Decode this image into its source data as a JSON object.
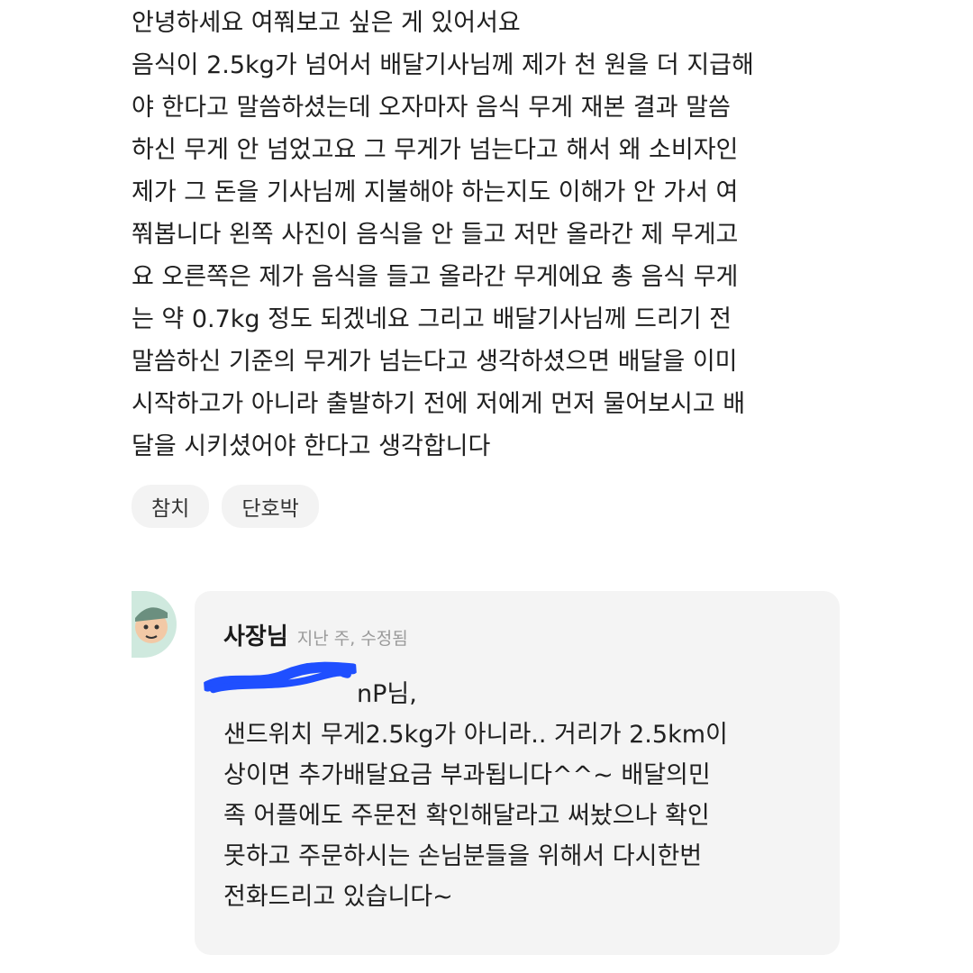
{
  "review": {
    "lines": [
      "안녕하세요 여쭤보고 싶은 게 있어서요",
      "음식이 2.5kg가 넘어서 배달기사님께 제가 천 원을 더 지급해",
      "야 한다고 말씀하셨는데 오자마자 음식 무게 재본 결과 말씀",
      "하신 무게 안 넘었고요 그 무게가 넘는다고 해서 왜 소비자인",
      "제가 그 돈을 기사님께 지불해야 하는지도 이해가 안 가서 여",
      "쭤봅니다 왼쪽 사진이 음식을 안 들고 저만 올라간 제 무게고",
      "요 오른쪽은 제가 음식을 들고 올라간 무게에요 총 음식 무게",
      "는 약 0.7kg 정도 되겠네요 그리고 배달기사님께 드리기 전",
      "말씀하신 기준의 무게가 넘는다고 생각하셨으면 배달을 이미",
      "시작하고가 아니라 출발하기 전에 저에게 먼저 물어보시고 배",
      "달을 시키셨어야 한다고 생각합니다"
    ],
    "tags": [
      "참치",
      "단호박"
    ]
  },
  "reply": {
    "author": "사장님",
    "meta": "지난 주, 수정됨",
    "lines": [
      "nP님,",
      "샌드위치 무게2.5kg가 아니라.. 거리가 2.5km이",
      "상이면  추가배달요금  부과됩니다^^~ 배달의민",
      "족 어플에도 주문전 확인해달라고 써놨으나 확인",
      "못하고 주문하시는 손님분들을 위해서 다시한번",
      "전화드리고 있습니다~"
    ]
  },
  "colors": {
    "redaction": "#1f4fff",
    "card_background": "#f4f4f4",
    "tag_background": "#f3f3f3",
    "avatar_background": "#cfe9de"
  },
  "icons": {
    "avatar": "owner-avatar-icon"
  }
}
